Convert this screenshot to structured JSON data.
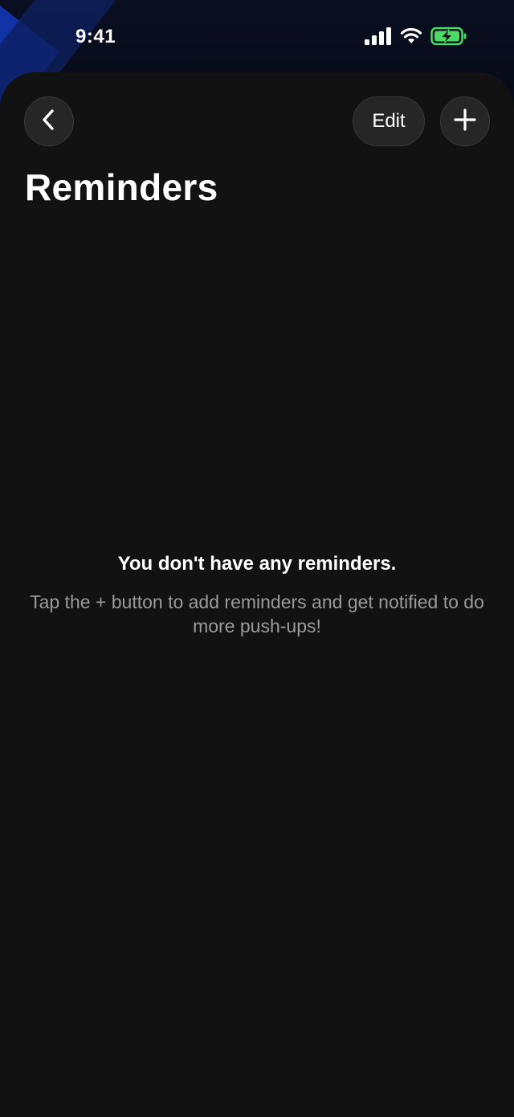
{
  "status_bar": {
    "time": "9:41",
    "icons": [
      "cellular-signal-icon",
      "wifi-icon",
      "battery-charging-icon"
    ],
    "battery_color": "#4cd964"
  },
  "nav": {
    "back_icon": "chevron-left-icon",
    "edit_label": "Edit",
    "add_icon": "plus-icon"
  },
  "page": {
    "title": "Reminders"
  },
  "empty_state": {
    "title": "You don't have any reminders.",
    "message": "Tap the + button to add reminders and get notified to do more push-ups!"
  },
  "colors": {
    "background": "#121212",
    "button_background": "#262626",
    "accent_blue": "#1233a8",
    "secondary_text": "#9a9a9a"
  }
}
